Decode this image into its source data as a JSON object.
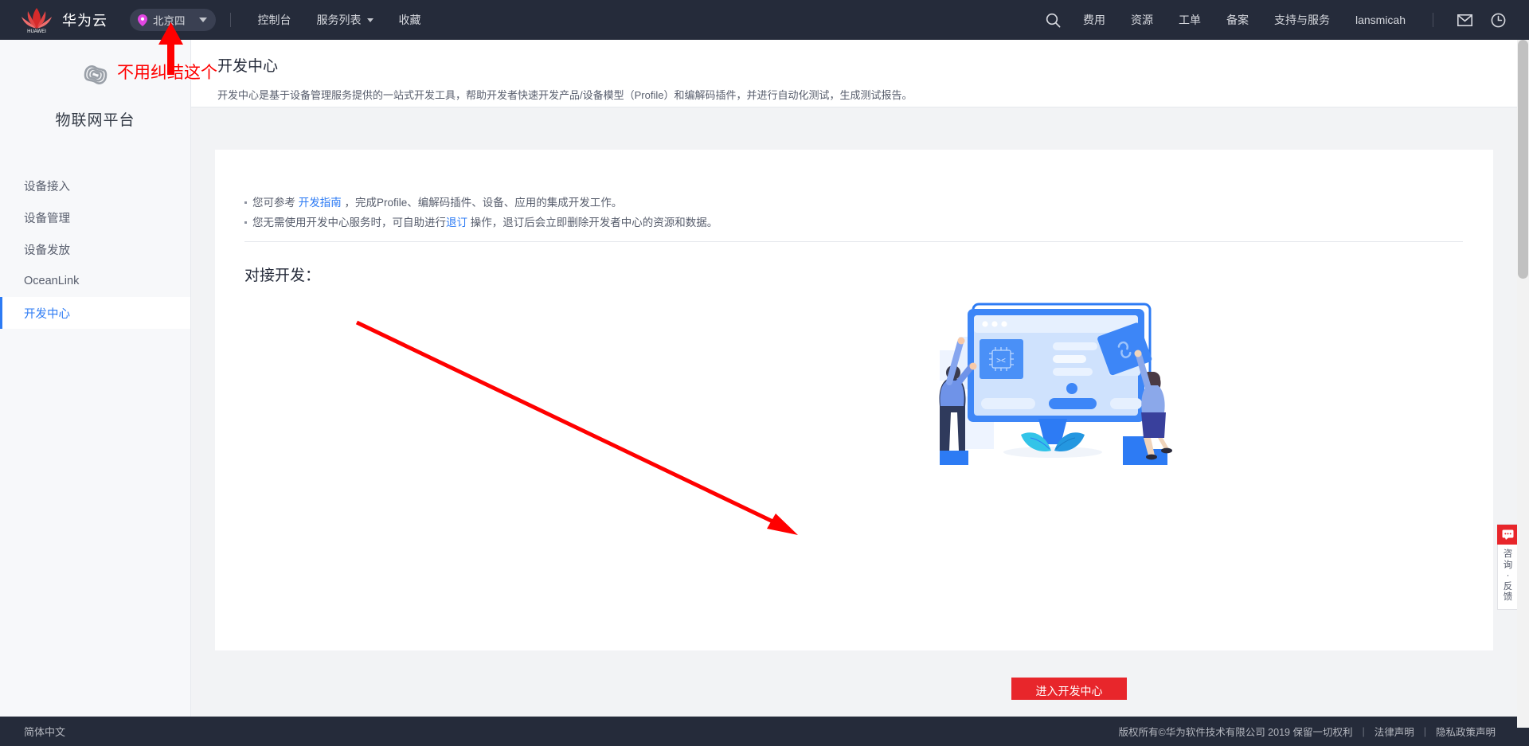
{
  "header": {
    "brand": "华为云",
    "logo_icon": "huawei-flower-logo",
    "region": {
      "pin_icon": "location-pin-icon",
      "label": "北京四",
      "caret_icon": "chevron-down-icon"
    },
    "nav": [
      {
        "label": "控制台",
        "has_caret": false
      },
      {
        "label": "服务列表",
        "has_caret": true
      },
      {
        "label": "收藏",
        "has_caret": false
      }
    ],
    "right_nav": [
      {
        "label": "费用"
      },
      {
        "label": "资源"
      },
      {
        "label": "工单"
      },
      {
        "label": "备案"
      },
      {
        "label": "支持与服务"
      },
      {
        "label": "lansmicah"
      }
    ],
    "search_icon": "search-icon",
    "mail_icon": "mail-envelope-icon",
    "clock_icon": "clock-icon"
  },
  "sidebar": {
    "logo_icon": "iot-infinity-logo",
    "product_name": "物联网平台",
    "items": [
      {
        "label": "设备接入",
        "active": false
      },
      {
        "label": "设备管理",
        "active": false
      },
      {
        "label": "设备发放",
        "active": false
      },
      {
        "label": "OceanLink",
        "active": false
      },
      {
        "label": "开发中心",
        "active": true
      }
    ]
  },
  "page": {
    "title": "开发中心",
    "description": "开发中心是基于设备管理服务提供的一站式开发工具，帮助开发者快速开发产品/设备模型（Profile）和编解码插件，并进行自动化测试，生成测试报告。"
  },
  "card": {
    "bullets": [
      {
        "pre": "您可参考 ",
        "link": "开发指南",
        "post": " ，完成Profile、编解码插件、设备、应用的集成开发工作。"
      },
      {
        "pre": "您无需使用开发中心服务时，可自助进行",
        "link": "退订",
        "post": " 操作，退订后会立即删除开发者中心的资源和数据。"
      }
    ],
    "section_title": "对接开发：",
    "illustration_icon": "developer-monitor-illustration",
    "enter_button": "进入开发中心"
  },
  "annotations": {
    "note_text": "不用纠结这个",
    "up_arrow_icon": "red-up-arrow-annotation",
    "diagonal_arrow_icon": "red-diagonal-arrow-annotation",
    "color": "#ff0000"
  },
  "feedback_widget": {
    "chat_icon": "chat-bubble-icon",
    "label": "咨询·反馈"
  },
  "footer": {
    "language": "简体中文",
    "copyright": "版权所有©华为软件技术有限公司 2019 保留一切权利",
    "links": [
      {
        "label": "法律声明"
      },
      {
        "label": "隐私政策声明"
      }
    ],
    "separator": "|"
  },
  "theme": {
    "header_bg": "#252b3a",
    "accent_blue": "#2d7bf4",
    "accent_red": "#e8262b",
    "page_bg": "#f2f3f5",
    "sidebar_bg": "#f7f8fa"
  }
}
